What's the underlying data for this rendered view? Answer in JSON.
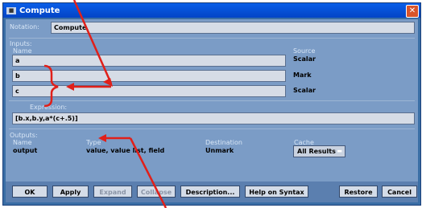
{
  "window": {
    "title": "Compute",
    "icon": "app-icon",
    "close": "✕"
  },
  "notation": {
    "label": "Notation:",
    "value": "Compute"
  },
  "inputs": {
    "label": "Inputs:",
    "col_name": "Name",
    "col_source": "Source",
    "rows": [
      {
        "name": "a",
        "source": "Scalar"
      },
      {
        "name": "b",
        "source": "Mark"
      },
      {
        "name": "c",
        "source": "Scalar"
      }
    ]
  },
  "expression": {
    "label": "Expression:",
    "value": "[b.x,b.y,a*(c+.5)]"
  },
  "outputs": {
    "label": "Outputs:",
    "col_name": "Name",
    "col_type": "Type",
    "col_destination": "Destination",
    "col_cache": "Cache",
    "row": {
      "name": "output",
      "type": "value, value list, field",
      "destination": "Unmark",
      "cache": "All Results"
    }
  },
  "buttons": {
    "ok": "OK",
    "apply": "Apply",
    "expand": "Expand",
    "collapse": "Collapse",
    "description": "Description...",
    "help": "Help on Syntax",
    "restore": "Restore",
    "cancel": "Cancel"
  },
  "colors": {
    "annotation": "#e0201a"
  }
}
